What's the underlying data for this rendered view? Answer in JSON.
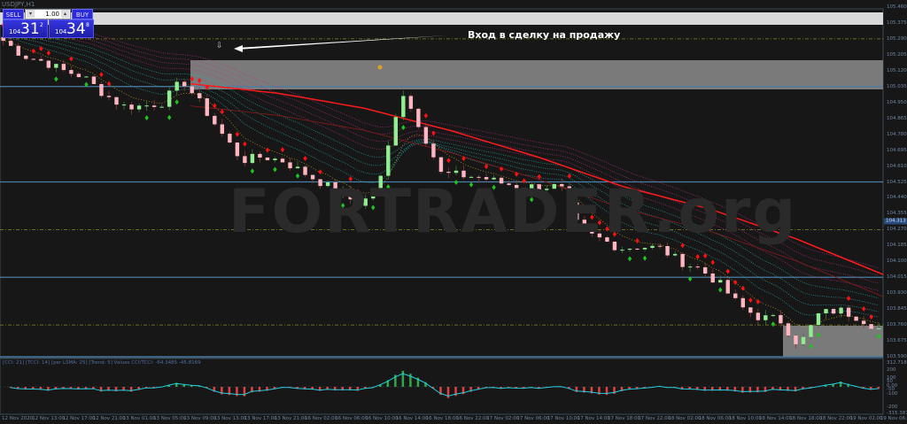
{
  "window": {
    "title": "USDJPY,H1"
  },
  "trade_panel": {
    "sell_label": "SELL",
    "buy_label": "BUY",
    "lot_value": "1.00",
    "sell_price": {
      "prefix": "104",
      "big": "31",
      "sup": "2"
    },
    "buy_price": {
      "prefix": "104",
      "big": "34",
      "sup": "8"
    }
  },
  "annotation": {
    "text": "Вход в сделку на продажу",
    "marker": "⇩"
  },
  "watermark": "FORTRADER.org",
  "price_axis": {
    "labels": [
      "105.460",
      "105.375",
      "105.290",
      "105.205",
      "105.120",
      "105.035",
      "104.950",
      "104.865",
      "104.780",
      "104.695",
      "104.610",
      "104.525",
      "104.440",
      "104.355",
      "104.270",
      "104.185",
      "104.100",
      "104.015",
      "103.930",
      "103.845",
      "103.760",
      "103.675",
      "103.590"
    ],
    "current_price": "104.313"
  },
  "indicator": {
    "label": "[CCI: 21] [TCCI: 14] [per LSMA: 25] [Trend: 5] Values CCI/TCCI: -64.3485 -45.8169",
    "axis_labels": [
      "312.7184",
      "200",
      "100",
      "50",
      "0.00",
      "-50",
      "-100",
      "-200",
      "-315.3879"
    ]
  },
  "time_axis": {
    "labels": [
      "12 Nov 2020",
      "12 Nov 13:00",
      "12 Nov 17:00",
      "12 Nov 21:00",
      "13 Nov 01:00",
      "13 Nov 05:00",
      "13 Nov 09:00",
      "13 Nov 13:00",
      "13 Nov 17:00",
      "13 Nov 21:00",
      "16 Nov 02:00",
      "16 Nov 06:00",
      "16 Nov 10:00",
      "16 Nov 14:00",
      "16 Nov 18:00",
      "16 Nov 22:00",
      "17 Nov 02:00",
      "17 Nov 06:00",
      "17 Nov 10:00",
      "17 Nov 14:00",
      "17 Nov 18:00",
      "17 Nov 22:00",
      "18 Nov 02:00",
      "18 Nov 06:00",
      "18 Nov 10:00",
      "18 Nov 14:00",
      "18 Nov 18:00",
      "18 Nov 22:00",
      "19 Nov 02:00",
      "19 Nov 06:00"
    ]
  },
  "colors": {
    "bull": "#90ee90",
    "bear": "#ffb6c1",
    "ma": "#ff1a1a",
    "ribbon_a": "#28b4b4",
    "ribbon_b": "#c0308a",
    "level": "#4a7fa8",
    "zone": "#808080",
    "buttons": "#2b2bd8"
  },
  "chart_data": {
    "type": "candlestick",
    "symbol": "USDJPY,H1",
    "ylim": [
      103.59,
      105.46
    ],
    "price_path": [
      105.28,
      105.2,
      105.17,
      105.12,
      105.09,
      105.0,
      104.93,
      104.93,
      104.95,
      105.07,
      104.93,
      104.78,
      104.64,
      104.66,
      104.64,
      104.58,
      104.52,
      104.46,
      104.4,
      104.55,
      105.02,
      104.81,
      104.57,
      104.56,
      104.55,
      104.52,
      104.5,
      104.5,
      104.5,
      104.26,
      104.22,
      104.17,
      104.18,
      104.17,
      104.1,
      104.06,
      103.98,
      103.86,
      103.8,
      103.79,
      103.65,
      103.82,
      103.84,
      103.8,
      103.74
    ],
    "ma_path": [
      105.05,
      105.0,
      104.92,
      104.8,
      104.66,
      104.5,
      104.38,
      104.22,
      104.03
    ],
    "levels_solid": [
      105.035,
      104.525,
      104.015,
      103.59
    ],
    "levels_dashed": [
      105.29,
      104.27,
      103.76
    ]
  }
}
